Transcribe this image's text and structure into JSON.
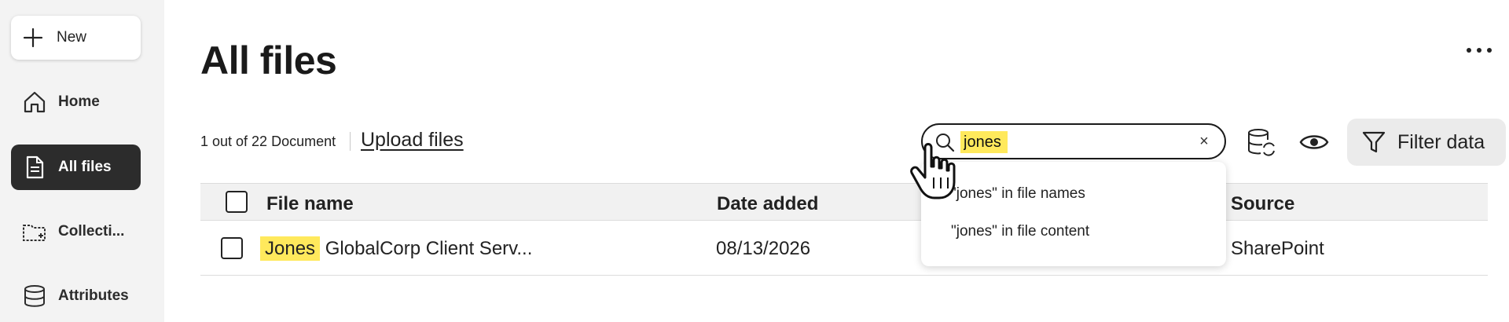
{
  "sidebar": {
    "new_label": "New",
    "items": [
      {
        "label": "Home",
        "icon": "home-icon"
      },
      {
        "label": "All files",
        "icon": "document-icon"
      },
      {
        "label": "Collecti...",
        "icon": "folder-icon"
      },
      {
        "label": "Attributes",
        "icon": "database-icon"
      }
    ]
  },
  "page": {
    "title": "All files"
  },
  "toolbar": {
    "count_text": "1 out of 22 Document",
    "upload_label": "Upload files",
    "filter_label": "Filter data"
  },
  "search": {
    "value": "jones",
    "clear_glyph": "×",
    "suggestions": [
      "\"jones\" in file names",
      "\"jones\" in file content"
    ]
  },
  "table": {
    "columns": [
      "File name",
      "Date added",
      "Source"
    ],
    "rows": [
      {
        "name_highlight": "Jones",
        "name_rest": " GlobalCorp Client Serv...",
        "date": "08/13/2026",
        "source": "SharePoint"
      }
    ]
  },
  "colors": {
    "highlight": "#ffe95c",
    "active_nav": "#2c2c2c",
    "sidebar_bg": "#f3f3f3"
  }
}
